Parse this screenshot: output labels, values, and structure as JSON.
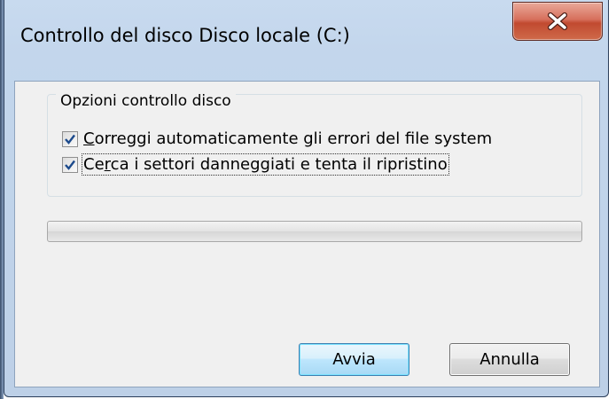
{
  "window": {
    "title": "Controllo del disco Disco locale (C:)"
  },
  "group": {
    "title": "Opzioni controllo disco"
  },
  "options": [
    {
      "accel": "C",
      "rest": "orreggi automaticamente gli errori del file system",
      "checked": true
    },
    {
      "pre": "Ce",
      "accel": "r",
      "rest": "ca i settori danneggiati e tenta il ripristino",
      "checked": true
    }
  ],
  "progress": {
    "value": 0
  },
  "buttons": {
    "start_label": "Avvia",
    "cancel_label": "Annulla"
  },
  "icons": {
    "close": "close-icon",
    "check": "checkmark-icon"
  },
  "colors": {
    "accent": "#3c7fb1",
    "close_button": "#c14a30",
    "checkmark": "#1c4a8c"
  }
}
